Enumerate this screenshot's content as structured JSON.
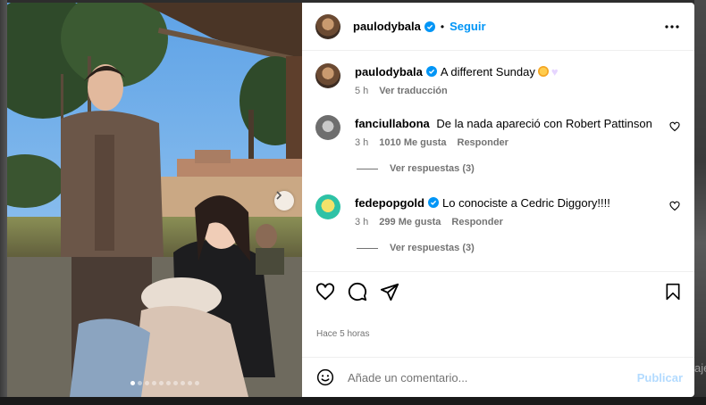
{
  "post": {
    "author": "paulodybala",
    "follow_label": "Seguir",
    "separator": "•",
    "caption": {
      "username": "paulodybala",
      "text": "A different Sunday",
      "time": "5 h",
      "translate_label": "Ver traducción"
    },
    "comments": [
      {
        "username": "fanciullabona",
        "text": "De la nada apareció con Robert Pattinson",
        "time": "3 h",
        "likes": "1010 Me gusta",
        "reply_label": "Responder",
        "view_replies": "Ver respuestas (3)"
      },
      {
        "username": "fedepopgold",
        "text": "Lo conociste a Cedric Diggory!!!!",
        "time": "3 h",
        "likes": "299 Me gusta",
        "reply_label": "Responder",
        "view_replies": "Ver respuestas (3)"
      }
    ],
    "posted_ago": "Hace 5 horas",
    "comment_placeholder": "Añade un comentario...",
    "publish_label": "Publicar",
    "carousel": {
      "total": 10,
      "active": 0
    }
  },
  "backdrop": {
    "edge_text": "aje"
  },
  "colors": {
    "accent": "#0095f6",
    "verified": "#0095f6",
    "muted": "#737373",
    "publish_disabled": "#b3dbff"
  },
  "icons": [
    "more-options-icon",
    "verified-badge-icon",
    "heart-icon",
    "comment-icon",
    "share-icon",
    "bookmark-icon",
    "emoji-icon",
    "chevron-right-icon"
  ]
}
